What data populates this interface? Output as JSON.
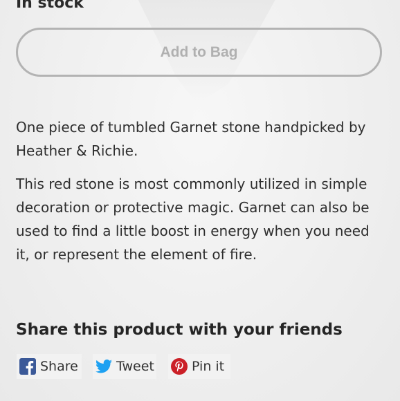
{
  "product": {
    "stock_status": "In stock",
    "add_to_bag_label": "Add to Bag",
    "description_paragraphs": [
      "One piece of tumbled Garnet stone handpicked by Heather & Richie.",
      "This red stone is most commonly utilized in simple decoration or protective magic. Garnet can also be used to find a little boost in energy when you need it, or represent the element of fire."
    ]
  },
  "share": {
    "heading": "Share this product with your friends",
    "buttons": [
      {
        "label": "Share",
        "icon": "facebook-icon",
        "color": "#3b5998"
      },
      {
        "label": "Tweet",
        "icon": "twitter-icon",
        "color": "#1da1f2"
      },
      {
        "label": "Pin it",
        "icon": "pinterest-icon",
        "color": "#cb2027"
      }
    ]
  },
  "colors": {
    "button_border": "#b3b3b3",
    "button_text": "#b0b0b0",
    "body_text": "#2e2e2e"
  }
}
